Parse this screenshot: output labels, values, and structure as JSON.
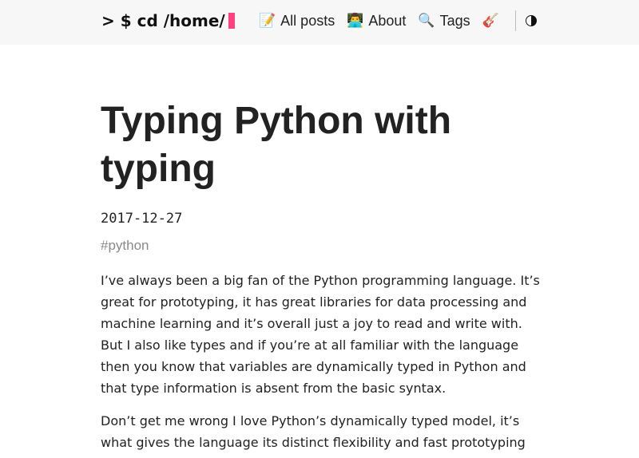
{
  "header": {
    "logo_text": "> $ cd /home/",
    "nav": [
      {
        "emoji": "📝",
        "label": "All posts"
      },
      {
        "emoji": "👨‍💻",
        "label": "About"
      },
      {
        "emoji": "🔍",
        "label": "Tags"
      },
      {
        "emoji": "🎸",
        "label": ""
      }
    ],
    "theme_toggle_icon": "half-circle-icon",
    "colors": {
      "cursor": "#ff4081",
      "header_bg": "#f7f7f7"
    }
  },
  "post": {
    "title": "Typing Python with typing",
    "date": "2017-12-27",
    "tag": "#python",
    "paragraphs": [
      "I’ve always been a big fan of the Python programming language. It’s great for prototyping, it has great libraries for data processing and machine learning and it’s overall just a joy to read and write with. But I also like types and if you’re at all familiar with the language then you know that variables are dynamically typed in Python and that type information is absent from the basic syntax.",
      "Don’t get me wrong I love Python’s dynamically typed model, it’s what gives the language its distinct flexibility and fast prototyping"
    ]
  }
}
